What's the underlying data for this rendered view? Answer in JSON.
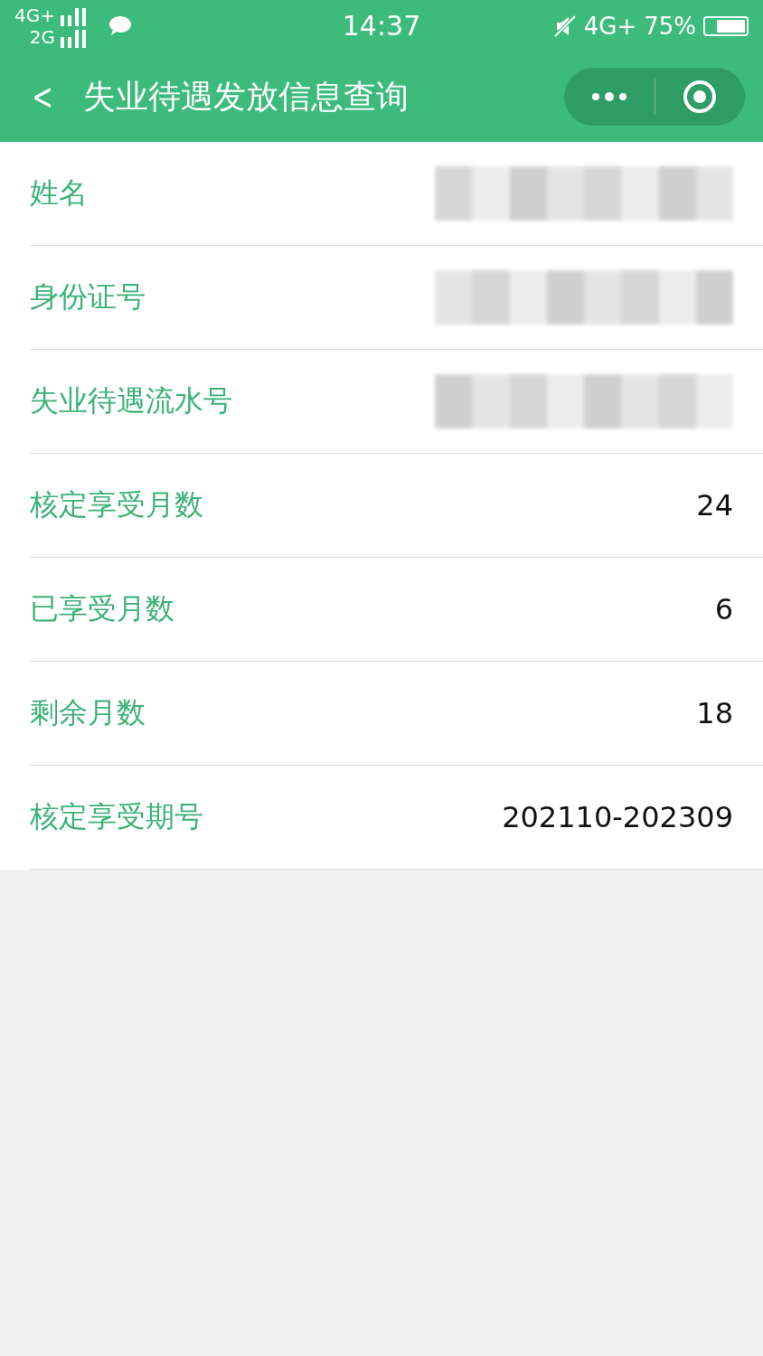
{
  "status_bar": {
    "network_top": "4G+",
    "network_bottom": "2G",
    "time": "14:37",
    "network_right": "4G+",
    "battery": "75%"
  },
  "nav": {
    "back": "<",
    "title": "失业待遇发放信息查询"
  },
  "rows": [
    {
      "label": "姓名",
      "kind": "redacted"
    },
    {
      "label": "身份证号",
      "kind": "redacted"
    },
    {
      "label": "失业待遇流水号",
      "kind": "redacted"
    },
    {
      "label": "核定享受月数",
      "kind": "text",
      "value": "24"
    },
    {
      "label": "已享受月数",
      "kind": "text",
      "value": "6"
    },
    {
      "label": "剩余月数",
      "kind": "text",
      "value": "18"
    },
    {
      "label": "核定享受期号",
      "kind": "text",
      "value": "202110-202309"
    }
  ]
}
